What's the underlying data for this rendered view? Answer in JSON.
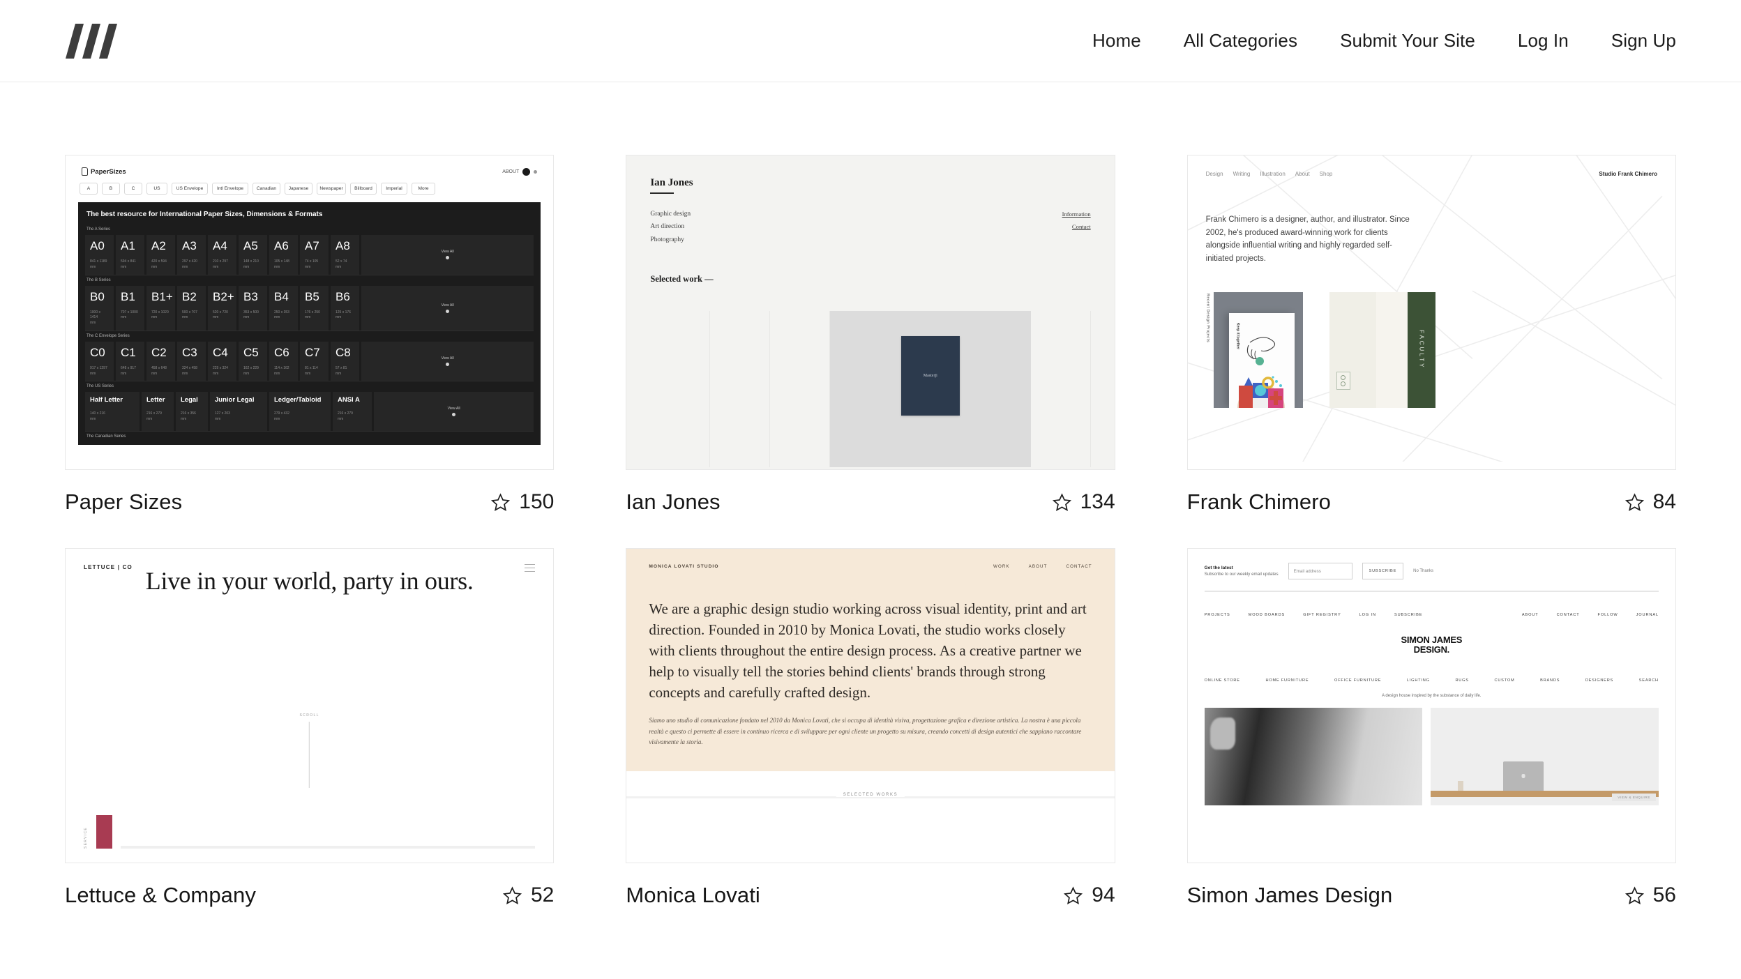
{
  "header": {
    "logo_name": "three-slash-logo",
    "nav": [
      {
        "label": "Home"
      },
      {
        "label": "All Categories"
      },
      {
        "label": "Submit Your Site"
      },
      {
        "label": "Log In"
      },
      {
        "label": "Sign Up"
      }
    ]
  },
  "cards": [
    {
      "title": "Paper Sizes",
      "stars": "150",
      "thumb": {
        "brand": "PaperSizes",
        "topright_text": "ABOUT",
        "tabs": [
          "A",
          "B",
          "C",
          "US",
          "US Envelope",
          "Intl Envelope",
          "Canadian",
          "Japanese",
          "Newspaper",
          "Billboard",
          "Imperial",
          "More"
        ],
        "headline": "The best resource for International Paper Sizes, Dimensions & Formats",
        "sections": [
          {
            "label": "The A Series",
            "cells": [
              {
                "name": "A0",
                "dim": "841 x 1189",
                "unit": "mm"
              },
              {
                "name": "A1",
                "dim": "594 x 841",
                "unit": "mm"
              },
              {
                "name": "A2",
                "dim": "420 x 594",
                "unit": "mm"
              },
              {
                "name": "A3",
                "dim": "297 x 420",
                "unit": "mm"
              },
              {
                "name": "A4",
                "dim": "210 x 297",
                "unit": "mm"
              },
              {
                "name": "A5",
                "dim": "148 x 210",
                "unit": "mm"
              },
              {
                "name": "A6",
                "dim": "105 x 148",
                "unit": "mm"
              },
              {
                "name": "A7",
                "dim": "74 x 105",
                "unit": "mm"
              },
              {
                "name": "A8",
                "dim": "52 x 74",
                "unit": "mm"
              }
            ],
            "view_all": "View All"
          },
          {
            "label": "The B Series",
            "cells": [
              {
                "name": "B0",
                "dim": "1000 x 1414",
                "unit": "mm"
              },
              {
                "name": "B1",
                "dim": "707 x 1000",
                "unit": "mm"
              },
              {
                "name": "B1+",
                "dim": "720 x 1020",
                "unit": "mm"
              },
              {
                "name": "B2",
                "dim": "500 x 707",
                "unit": "mm"
              },
              {
                "name": "B2+",
                "dim": "520 x 720",
                "unit": "mm"
              },
              {
                "name": "B3",
                "dim": "353 x 500",
                "unit": "mm"
              },
              {
                "name": "B4",
                "dim": "250 x 353",
                "unit": "mm"
              },
              {
                "name": "B5",
                "dim": "176 x 250",
                "unit": "mm"
              },
              {
                "name": "B6",
                "dim": "125 x 176",
                "unit": "mm"
              }
            ],
            "view_all": "View All"
          },
          {
            "label": "The C Envelope Series",
            "cells": [
              {
                "name": "C0",
                "dim": "917 x 1297",
                "unit": "mm"
              },
              {
                "name": "C1",
                "dim": "648 x 917",
                "unit": "mm"
              },
              {
                "name": "C2",
                "dim": "458 x 648",
                "unit": "mm"
              },
              {
                "name": "C3",
                "dim": "324 x 458",
                "unit": "mm"
              },
              {
                "name": "C4",
                "dim": "229 x 324",
                "unit": "mm"
              },
              {
                "name": "C5",
                "dim": "162 x 229",
                "unit": "mm"
              },
              {
                "name": "C6",
                "dim": "114 x 162",
                "unit": "mm"
              },
              {
                "name": "C7",
                "dim": "81 x 114",
                "unit": "mm"
              },
              {
                "name": "C8",
                "dim": "57 x 81",
                "unit": "mm"
              }
            ],
            "view_all": "View All"
          },
          {
            "label": "The US Series",
            "cells": [
              {
                "name": "Half Letter",
                "dim": "140 x 216",
                "unit": "mm"
              },
              {
                "name": "Letter",
                "dim": "216 x 279",
                "unit": "mm"
              },
              {
                "name": "Legal",
                "dim": "216 x 356",
                "unit": "mm"
              },
              {
                "name": "Junior Legal",
                "dim": "127 x 203",
                "unit": "mm"
              },
              {
                "name": "Ledger/Tabloid",
                "dim": "279 x 432",
                "unit": "mm"
              },
              {
                "name": "ANSI A",
                "dim": "216 x 279",
                "unit": "mm"
              }
            ],
            "view_all": "View All"
          },
          {
            "label": "The Canadian Series",
            "cells": [],
            "view_all": ""
          }
        ]
      }
    },
    {
      "title": "Ian Jones",
      "stars": "134",
      "thumb": {
        "name": "Ian Jones",
        "services": [
          "Graphic design",
          "Art direction",
          "Photography"
        ],
        "links": [
          "Information",
          "Contact"
        ],
        "selected_work": "Selected work —",
        "book_label": "Masterji"
      }
    },
    {
      "title": "Frank Chimero",
      "stars": "84",
      "thumb": {
        "nav": [
          "Design",
          "Writing",
          "Illustration",
          "About",
          "Shop"
        ],
        "studio": "Studio Frank Chimero",
        "intro": "Frank Chimero is a designer, author, and illustrator. Since 2002, he's produced award-winning work for clients alongside influential writing and highly regarded self-initiated projects.",
        "work_label": "Recent Design Projects",
        "poster_text": "Keep it together",
        "book_spine": "FACULTY"
      }
    },
    {
      "title": "Lettuce & Company",
      "stars": "52",
      "thumb": {
        "logo": "LETTUCE | CO",
        "headline": "Live in your world, party in ours.",
        "scroll_label": "SCROLL",
        "side_label": "SERVICE"
      }
    },
    {
      "title": "Monica Lovati",
      "stars": "94",
      "thumb": {
        "brand": "MONICA LOVATI STUDIO",
        "nav": [
          "WORK",
          "ABOUT",
          "CONTACT"
        ],
        "body": "We are a graphic design studio working across visual identity, print and art direction. Founded in 2010 by Monica Lovati, the studio works closely with clients throughout the entire design process. As a creative partner we help to visually tell the stories behind clients' brands through strong concepts and carefully crafted design.",
        "body_it": "Siamo uno studio di comunicazione fondato nel 2010 da Monica Lovati, che si occupa di identità visiva, progettazione grafica e direzione artistica. La nostra è una piccola realtà e questo ci permette di essere in continuo ricerca e di sviluppare per ogni cliente un progetto su misura, creando concetti di design autentici che sappiano raccontare visivamente la storia.",
        "selected": "SELECTED WORKS"
      }
    },
    {
      "title": "Simon James Design",
      "stars": "56",
      "thumb": {
        "sub_title": "Get the latest",
        "sub_text": "Subscribe to our weekly email updates",
        "email_placeholder": "Email address",
        "subscribe_button": "SUBSCRIBE",
        "no_thanks": "No Thanks",
        "links_left": [
          "PROJECTS",
          "MOOD BOARDS",
          "GIFT REGISTRY",
          "LOG IN",
          "SUBSCRIBE"
        ],
        "links_right": [
          "ABOUT",
          "CONTACT",
          "FOLLOW",
          "JOURNAL"
        ],
        "logo_line1": "SIMON JAMES",
        "logo_line2": "DESIGN.",
        "categories": [
          "ONLINE STORE",
          "HOME FURNITURE",
          "OFFICE FURNITURE",
          "LIGHTING",
          "RUGS",
          "CUSTOM",
          "BRANDS",
          "DESIGNERS",
          "SEARCH"
        ],
        "caption": "A design house inspired by the substance of daily life.",
        "photo_chip": "VIEW & ENQUIRE"
      }
    }
  ],
  "icons": {
    "star": "star-outline-icon"
  }
}
